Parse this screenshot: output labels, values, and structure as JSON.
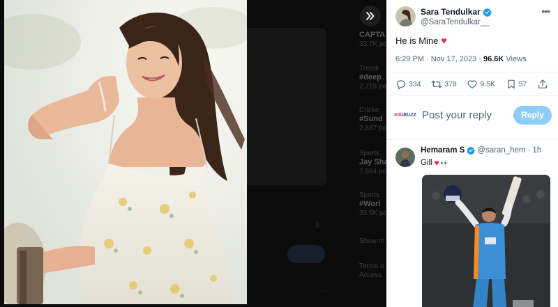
{
  "background_timeline": {
    "trends": [
      {
        "category": "",
        "tag": "CAPTA",
        "count": "33.7K po"
      },
      {
        "category": "Trendi",
        "tag": "#deep",
        "count": "2,715 po"
      },
      {
        "category": "Cricke",
        "tag": "#Sund",
        "count": "2,837 po"
      },
      {
        "category": "Sports",
        "tag": "Jay Sha",
        "count": "7,564 po"
      },
      {
        "category": "Sports",
        "tag": "#Worl",
        "count": "33.5K po"
      }
    ],
    "footer_text": [
      "Show m",
      "Terms o",
      "Access"
    ]
  },
  "viewer": {
    "expand_icon": "double-chevron-right-icon"
  },
  "tweet": {
    "author_name": "Sara Tendulkar",
    "author_handle": "@SaraTendulkar__",
    "text": "He is Mine",
    "emoji": "♥",
    "time": "6:29 PM",
    "date": "Nov 17, 2023",
    "views_count": "96.6K",
    "views_label": "Views",
    "separator": "·",
    "replies": "334",
    "reposts": "378",
    "likes": "9.5K",
    "bookmarks": "57"
  },
  "composer": {
    "avatar_text_1": "Info",
    "avatar_text_2": "BUZZ",
    "placeholder": "Post your reply",
    "reply_button": "Reply"
  },
  "reply": {
    "name": "Hemaram S",
    "handle": "@saran_hem",
    "separator": "·",
    "time": "1h",
    "text": "Gill",
    "emoji": "♥",
    "eyes": "👀"
  },
  "colors": {
    "accent": "#1d9bf0",
    "reply_button": "#8ecdf7",
    "heart": "#e0245e",
    "backdrop": "#0b0b0b"
  }
}
